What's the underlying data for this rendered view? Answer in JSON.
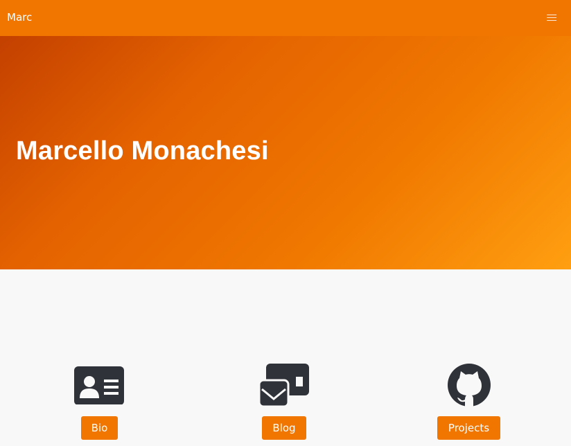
{
  "navbar": {
    "brand": "Marc",
    "menu_icon": "hamburger-icon"
  },
  "hero": {
    "title": "Marcello Monachesi"
  },
  "links": [
    {
      "label": "Bio",
      "icon": "id-card-icon"
    },
    {
      "label": "Blog",
      "icon": "envelope-icon"
    },
    {
      "label": "Projects",
      "icon": "github-icon"
    }
  ],
  "colors": {
    "accent": "#f07600",
    "hero_start": "#c34000",
    "hero_end": "#ff9f10",
    "icon": "#2f3238",
    "background": "#f8f8f8"
  }
}
